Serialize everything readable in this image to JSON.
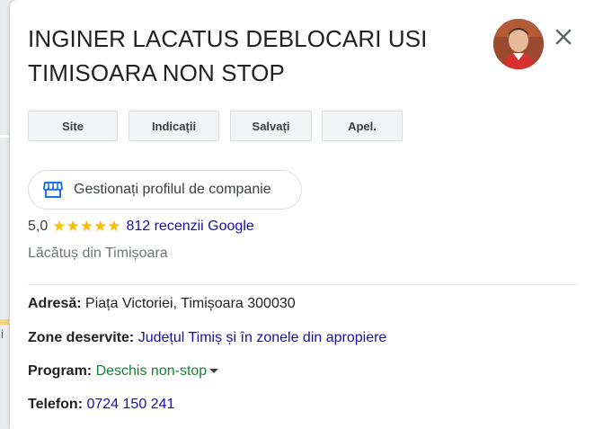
{
  "business": {
    "title": "INGINER LACATUS DEBLOCARI USI TIMISOARA NON STOP",
    "title_line1": "INGINER LACATUS DEBLOCARI USI",
    "title_line2": "TIMISOARA NON STOP"
  },
  "actions": [
    {
      "label": "Site"
    },
    {
      "label": "Indicații"
    },
    {
      "label": "Salvați"
    },
    {
      "label": "Apel."
    }
  ],
  "manage_profile": {
    "label": "Gestionați profilul de companie",
    "icon": "storefront-icon"
  },
  "rating": {
    "score": "5,0",
    "stars": "★★★★★",
    "reviews": "812 recenzii Google"
  },
  "category": "Lăcătuș din Timișoara",
  "details": {
    "address": {
      "label": "Adresă:",
      "value": "Piața Victoriei, Timișoara 300030"
    },
    "zones": {
      "label": "Zone deservite:",
      "value": "Județul Timiș și în zonele din apropiere"
    },
    "hours": {
      "label": "Program:",
      "value": "Deschis non-stop"
    },
    "phone": {
      "label": "Telefon:",
      "value": "0724 150 241"
    }
  },
  "map_glyph": "i",
  "colors": {
    "accent_blue": "#1a0dab",
    "open_green": "#188038",
    "star_yellow": "#fbbc04",
    "manage_icon_blue": "#1a73e8"
  }
}
